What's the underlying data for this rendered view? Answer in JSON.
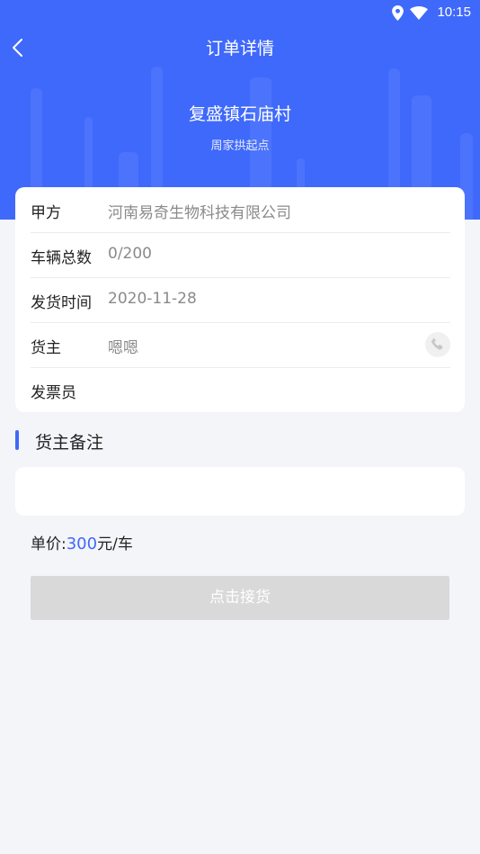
{
  "status_bar": {
    "time": "10:15",
    "icons": [
      "location-icon",
      "wifi-icon"
    ]
  },
  "nav": {
    "title": "订单详情",
    "back_icon": "chevron-left-icon"
  },
  "route": {
    "destination": "复盛镇石庙村",
    "origin": "周家拱起点"
  },
  "info": {
    "party_a_label": "甲方",
    "party_a_value": "河南易奇生物科技有限公司",
    "vehicles_label": "车辆总数",
    "vehicles_value": "0/200",
    "ship_time_label": "发货时间",
    "ship_time_value": "2020-11-28",
    "owner_label": "货主",
    "owner_value": "嗯嗯",
    "owner_phone_icon": "phone-icon",
    "invoicer_label": "发票员",
    "invoicer_value": ""
  },
  "remark": {
    "title": "货主备注",
    "content": ""
  },
  "price": {
    "label": "单价:",
    "amount": "300",
    "unit": "元/车"
  },
  "action": {
    "accept_label": "点击接货"
  },
  "colors": {
    "primary": "#3f69fb",
    "background": "#f4f5f9",
    "card": "#ffffff",
    "button_disabled": "#d9d9d9",
    "label_text": "#222222",
    "value_text": "#8a8a8a"
  }
}
